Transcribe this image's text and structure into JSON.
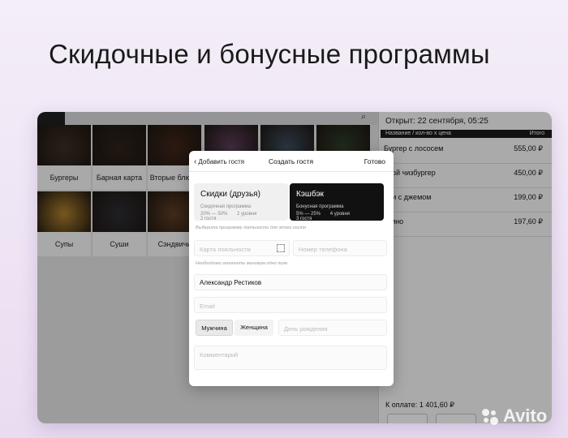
{
  "slide": {
    "title": "Скидочные и бонусные программы"
  },
  "menu": {
    "tiles": [
      {
        "label": "Бургеры",
        "color": "#3b2b22"
      },
      {
        "label": "Барная карта",
        "color": "#2c2018"
      },
      {
        "label": "Вторые блюда",
        "color": "#3e2418"
      },
      {
        "label": "",
        "color": "#5a3c55"
      },
      {
        "label": "",
        "color": "#3c4a5a"
      },
      {
        "label": "",
        "color": "#2d3b28"
      },
      {
        "label": "Супы",
        "color": "#a87a2a"
      },
      {
        "label": "Суши",
        "color": "#2b2b30"
      },
      {
        "label": "Сэндвичи",
        "color": "#5a3a22"
      }
    ]
  },
  "order": {
    "opened": "Открыт: 22 сентября, 05:25",
    "header_left": "Название / кол-во x цена",
    "header_right": "Итого",
    "items": [
      {
        "name": "Бургер с лососем",
        "price": "555,00 ₽",
        "sub": ""
      },
      {
        "name": "йной чизбургер",
        "price": "450,00 ₽",
        "sub": ""
      },
      {
        "name": "али с джемом",
        "price": "199,00 ₽",
        "sub": ""
      },
      {
        "name": "учино",
        "price": "197,60 ₽",
        "sub": "₽"
      }
    ],
    "total": "К оплате: 1 401,60 ₽"
  },
  "modal": {
    "back_label": "Добавить гостя",
    "title": "Создать гостя",
    "done_label": "Готово",
    "programs": [
      {
        "title": "Скидки (друзья)",
        "subtitle": "Скидочная программа",
        "range": "20% — 50%",
        "levels": "2 уровня",
        "guests": "2 гостя"
      },
      {
        "title": "Кэшбэк",
        "subtitle": "Бонусная программа",
        "range": "5% — 25%",
        "levels": "4 уровня",
        "guests": "3 гостя"
      }
    ],
    "program_hint": "Выберите программу лояльности для этого гостя",
    "loyalty_card_placeholder": "Карта лояльности",
    "phone_placeholder": "Номер телефона",
    "fields_hint": "Необходимо заполнить минимум одно поле",
    "name_value": "Александр Рестиков",
    "email_placeholder": "Email",
    "gender_male": "Мужчина",
    "gender_female": "Женщина",
    "birthday_placeholder": "День рождения",
    "comment_placeholder": "Комментарий"
  },
  "watermark": {
    "text": "Avito"
  }
}
